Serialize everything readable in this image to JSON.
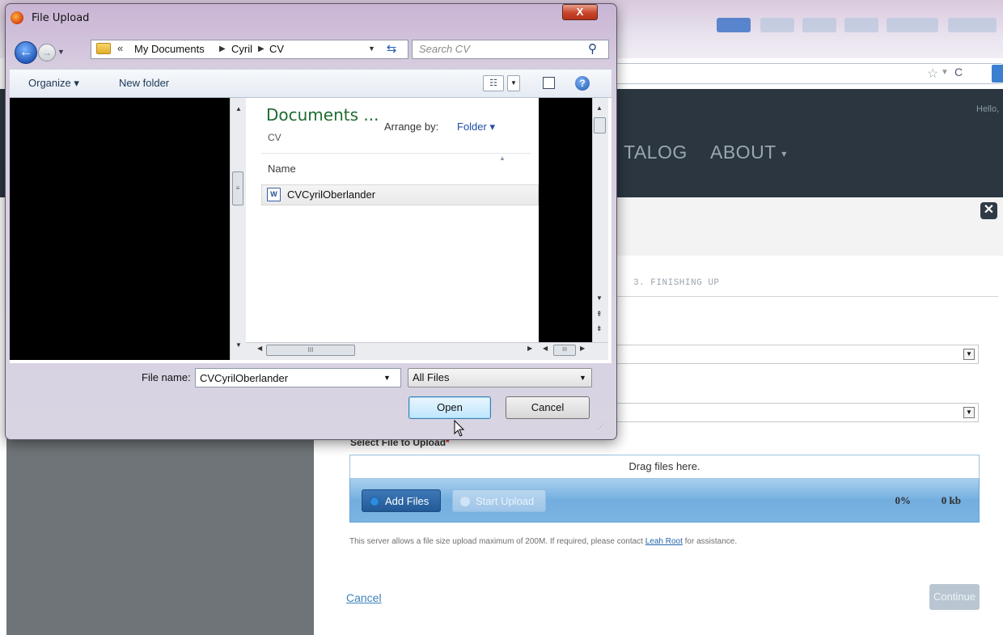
{
  "background_page": {
    "nav": {
      "catalog": "TALOG",
      "about": "ABOUT"
    },
    "hello_text": "Hello,",
    "step_label": "3. FINISHING UP",
    "select_file_label": "Select File to Upload",
    "required_marker": "*",
    "drop_zone_text": "Drag files here.",
    "add_files_label": "Add Files",
    "start_upload_label": "Start Upload",
    "progress_percent": "0%",
    "progress_size": "0 kb",
    "size_note_before": "This server allows a file size upload maximum of 200M. If required, please contact ",
    "size_note_link": "Leah Root",
    "size_note_after": " for assistance.",
    "cancel_link": "Cancel",
    "continue_label": "Continue",
    "close_glyph": "✕"
  },
  "dialog": {
    "title": "File Upload",
    "close_glyph": "X",
    "address": {
      "overflow": "«",
      "crumbs": [
        "My Documents",
        "Cyril",
        "CV"
      ]
    },
    "search_placeholder": "Search CV",
    "toolbar": {
      "organize": "Organize ▾",
      "new_folder": "New folder"
    },
    "library": {
      "title": "Documents ...",
      "subtitle": "CV",
      "arrange_by_label": "Arrange by:",
      "arrange_by_value": "Folder ▾"
    },
    "columns": {
      "name": "Name"
    },
    "files": [
      {
        "name": "CVCyrilOberlander",
        "type": "word-document"
      }
    ],
    "file_name_label": "File name:",
    "file_name_value": "CVCyrilOberlander",
    "file_type_value": "All Files",
    "open_label": "Open",
    "cancel_label": "Cancel"
  },
  "colors": {
    "header": "#2b3640",
    "accent_blue": "#3d83bd",
    "library_title": "#1f6b30"
  }
}
